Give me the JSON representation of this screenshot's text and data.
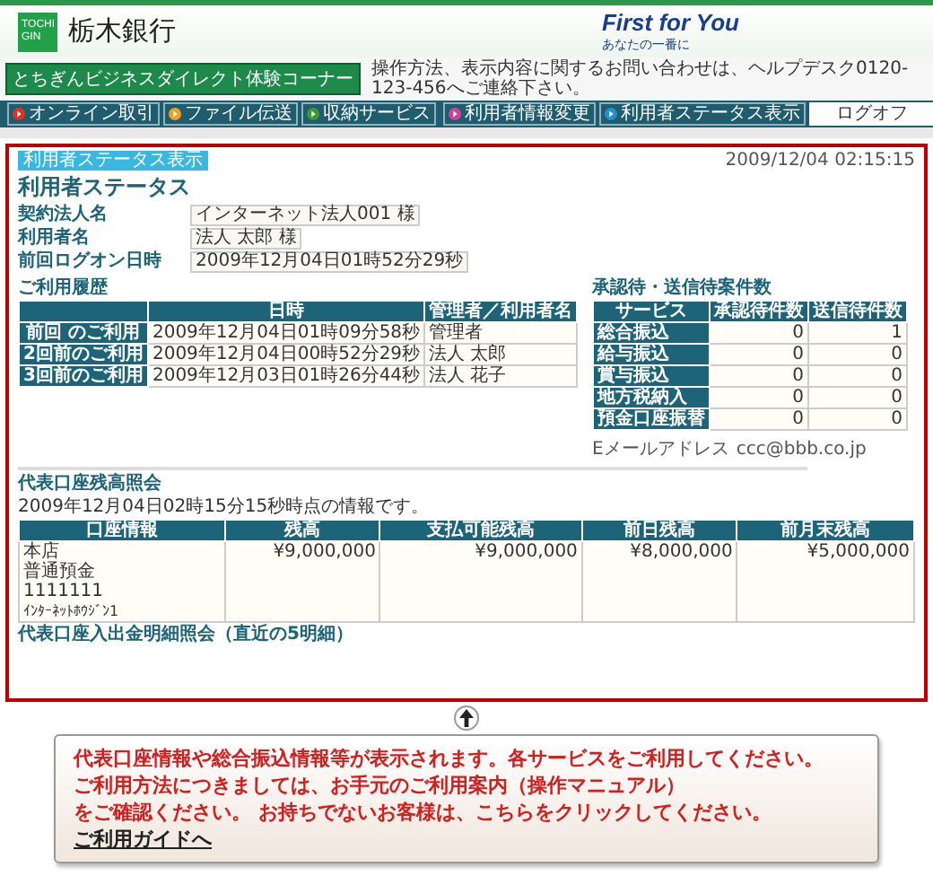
{
  "header": {
    "logo_mark": [
      "TOCHI",
      "GIN"
    ],
    "bank_name": "栃木銀行",
    "slogan": "First for You",
    "slogan_sub": "あなたの一番に"
  },
  "notice": {
    "label": "とちぎんビジネスダイレクト体験コーナー",
    "message": "操作方法、表示内容に関するお問い合わせは、ヘルプデスク0120-123-456へご連絡下さい。"
  },
  "nav": {
    "left": [
      {
        "label": "オンライン取引",
        "color": "#e0301e"
      },
      {
        "label": "ファイル伝送",
        "color": "#f0a020"
      },
      {
        "label": "収納サービス",
        "color": "#3a9a3a"
      }
    ],
    "right": [
      {
        "label": "利用者情報変更",
        "color": "#d040a0"
      },
      {
        "label": "利用者ステータス表示",
        "color": "#2090d0"
      }
    ],
    "logoff": "ログオフ"
  },
  "content": {
    "tag": "利用者ステータス表示",
    "timestamp": "2009/12/04 02:15:15",
    "title": "利用者ステータス",
    "info": [
      {
        "label": "契約法人名",
        "value": "インターネット法人001 様"
      },
      {
        "label": "利用者名",
        "value": "法人 太郎 様"
      },
      {
        "label": "前回ログオン日時",
        "value": "2009年12月04日01時52分29秒"
      }
    ],
    "history": {
      "heading": "ご利用履歴",
      "columns": [
        "",
        "日時",
        "管理者／利用者名"
      ],
      "rows": [
        [
          "前回 のご利用",
          "2009年12月04日01時09分58秒",
          "管理者"
        ],
        [
          "2回前のご利用",
          "2009年12月04日00時52分29秒",
          "法人 太郎"
        ],
        [
          "3回前のご利用",
          "2009年12月03日01時26分44秒",
          "法人 花子"
        ]
      ]
    },
    "pending": {
      "heading": "承認待・送信待案件数",
      "columns": [
        "サービス",
        "承認待件数",
        "送信待件数"
      ],
      "rows": [
        [
          "総合振込",
          "0",
          "1"
        ],
        [
          "給与振込",
          "0",
          "0"
        ],
        [
          "賞与振込",
          "0",
          "0"
        ],
        [
          "地方税納入",
          "0",
          "0"
        ],
        [
          "預金口座振替",
          "0",
          "0"
        ]
      ]
    },
    "email": {
      "label": "Eメールアドレス",
      "value": "ccc@bbb.co.jp"
    },
    "balance": {
      "heading": "代表口座残高照会",
      "note": "2009年12月04日02時15分15秒時点の情報です。",
      "columns": [
        "口座情報",
        "残高",
        "支払可能残高",
        "前日残高",
        "前月末残高"
      ],
      "account": [
        "本店",
        "普通預金",
        "1111111",
        "ｲﾝﾀｰﾈｯﾄﾎｳｼﾞﾝ1"
      ],
      "amounts": [
        "¥9,000,000",
        "¥9,000,000",
        "¥8,000,000",
        "¥5,000,000"
      ]
    },
    "next_heading": "代表口座入出金明細照会（直近の5明細）"
  },
  "callout": {
    "lines": [
      "代表口座情報や総合振込情報等が表示されます。各サービスをご利用してください。",
      "ご利用方法につきましては、お手元のご利用案内（操作マニュアル）",
      "をご確認ください。 お持ちでないお客様は、こちらをクリックしてください。"
    ],
    "link": "ご利用ガイドへ"
  }
}
